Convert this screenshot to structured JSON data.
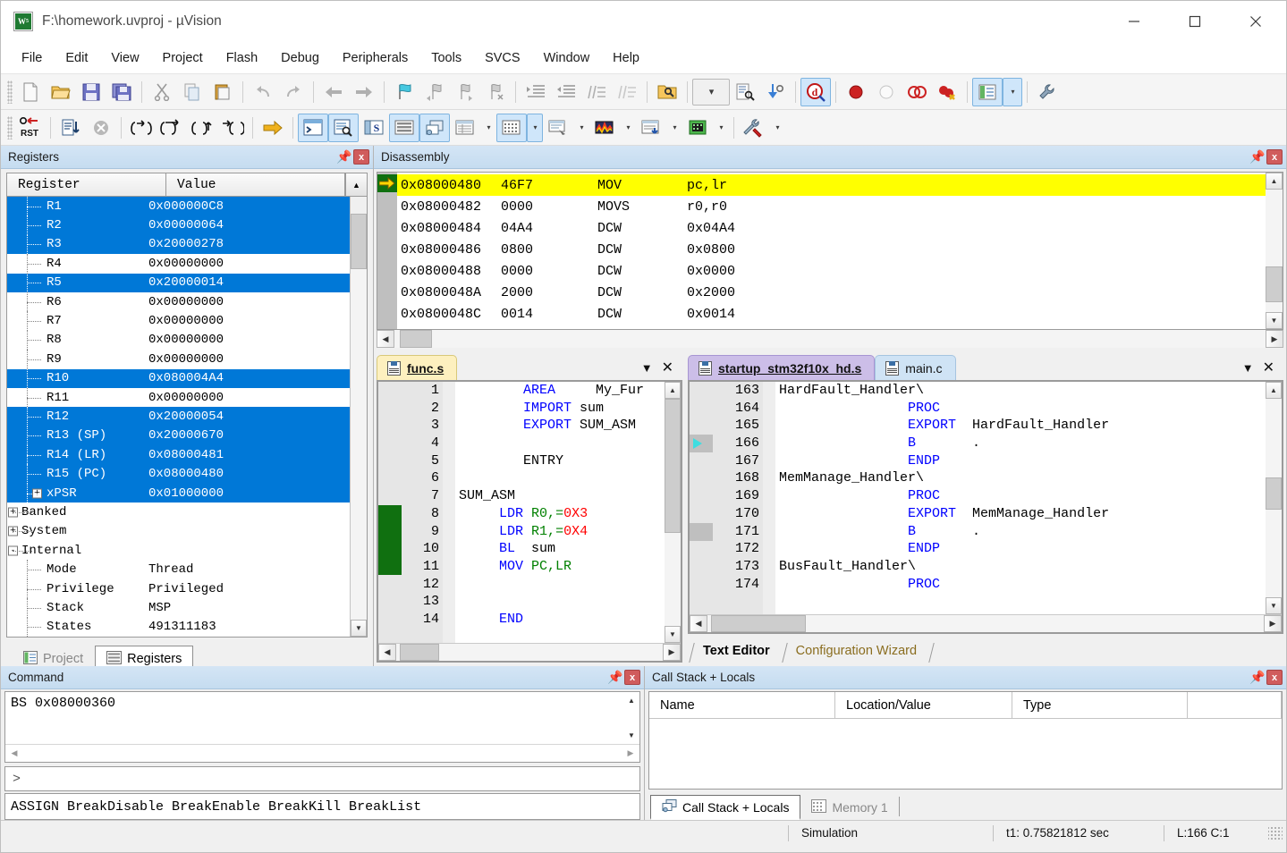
{
  "window": {
    "title": "F:\\homework.uvproj - µVision",
    "icon": "uvision-logo-icon",
    "controls": {
      "minimize": "minimize-icon",
      "maximize": "maximize-icon",
      "close": "close-icon"
    }
  },
  "menubar": {
    "items": [
      "File",
      "Edit",
      "View",
      "Project",
      "Flash",
      "Debug",
      "Peripherals",
      "Tools",
      "SVCS",
      "Window",
      "Help"
    ]
  },
  "toolbar_main": {
    "buttons": [
      {
        "name": "new-file-icon",
        "glyph": "□"
      },
      {
        "name": "open-file-icon",
        "glyph": "📂"
      },
      {
        "name": "save-icon",
        "glyph": "💾"
      },
      {
        "name": "save-all-icon",
        "glyph": "💾"
      },
      {
        "name": "cut-icon",
        "glyph": "✂"
      },
      {
        "name": "copy-icon",
        "glyph": "⧉"
      },
      {
        "name": "paste-icon",
        "glyph": "📋"
      },
      {
        "name": "undo-icon",
        "glyph": "↶"
      },
      {
        "name": "redo-icon",
        "glyph": "↷"
      },
      {
        "name": "navigate-backward-icon",
        "glyph": "←"
      },
      {
        "name": "navigate-forward-icon",
        "glyph": "→"
      },
      {
        "name": "bookmark-toggle-icon",
        "glyph": "⚑"
      },
      {
        "name": "bookmark-prev-icon",
        "glyph": "⚑"
      },
      {
        "name": "bookmark-next-icon",
        "glyph": "⚑"
      },
      {
        "name": "bookmark-clear-icon",
        "glyph": "⚑"
      },
      {
        "name": "indent-icon",
        "glyph": "⇥"
      },
      {
        "name": "outdent-icon",
        "glyph": "⇤"
      },
      {
        "name": "comment-icon",
        "glyph": "//"
      },
      {
        "name": "uncomment-icon",
        "glyph": "//"
      },
      {
        "name": "find-in-files-icon",
        "glyph": "🔍"
      },
      {
        "name": "find-dropdown-icon",
        "glyph": "▾"
      },
      {
        "name": "find-icon",
        "glyph": "🔎"
      },
      {
        "name": "goto-definition-icon",
        "glyph": "↓"
      },
      {
        "name": "start-stop-debug-icon",
        "glyph": "d",
        "active": true
      },
      {
        "name": "insert-breakpoint-icon",
        "glyph": "●"
      },
      {
        "name": "disable-breakpoint-icon",
        "glyph": "○"
      },
      {
        "name": "disable-all-breakpoints-icon",
        "glyph": "◌"
      },
      {
        "name": "kill-all-breakpoints-icon",
        "glyph": "●"
      },
      {
        "name": "manage-project-items-icon",
        "glyph": "▤",
        "active": true
      },
      {
        "name": "manage-dropdown-icon",
        "glyph": "▾"
      },
      {
        "name": "configure-target-options-icon",
        "glyph": "🔧"
      }
    ]
  },
  "toolbar_debug": {
    "buttons": [
      {
        "name": "reset-cpu-icon",
        "glyph": "RST"
      },
      {
        "name": "run-icon",
        "glyph": "≡↓"
      },
      {
        "name": "stop-icon",
        "glyph": "⊗"
      },
      {
        "name": "step-icon",
        "glyph": "{→}"
      },
      {
        "name": "step-over-icon",
        "glyph": "{}→"
      },
      {
        "name": "step-out-icon",
        "glyph": "{}↑"
      },
      {
        "name": "run-to-cursor-icon",
        "glyph": "→{}"
      },
      {
        "name": "show-next-statement-icon",
        "glyph": "⇨"
      },
      {
        "name": "command-window-icon",
        "glyph": "≥",
        "active": true
      },
      {
        "name": "disassembly-window-icon",
        "glyph": "🔍",
        "active": true
      },
      {
        "name": "symbols-window-icon",
        "glyph": "S"
      },
      {
        "name": "registers-window-icon",
        "glyph": "▤",
        "active": true
      },
      {
        "name": "call-stack-window-icon",
        "glyph": "⧉",
        "active": true
      },
      {
        "name": "watch-windows-icon",
        "glyph": "▦"
      },
      {
        "name": "watch-dropdown-icon",
        "glyph": "▾"
      },
      {
        "name": "memory-windows-icon",
        "glyph": "▦",
        "active": true
      },
      {
        "name": "memory-dropdown-icon",
        "glyph": "▾"
      },
      {
        "name": "serial-windows-icon",
        "glyph": "⌨"
      },
      {
        "name": "serial-dropdown-icon",
        "glyph": "▾"
      },
      {
        "name": "analysis-windows-icon",
        "glyph": "〜"
      },
      {
        "name": "analysis-dropdown-icon",
        "glyph": "▾"
      },
      {
        "name": "trace-windows-icon",
        "glyph": "↓"
      },
      {
        "name": "trace-dropdown-icon",
        "glyph": "▾"
      },
      {
        "name": "system-viewer-icon",
        "glyph": "▣"
      },
      {
        "name": "system-viewer-dropdown-icon",
        "glyph": "▾"
      },
      {
        "name": "toolbox-icon",
        "glyph": "🔨"
      },
      {
        "name": "toolbox-dropdown-icon",
        "glyph": "▾"
      }
    ]
  },
  "registers_panel": {
    "title": "Registers",
    "pin_icon": "pin-icon",
    "close_icon": "close-icon",
    "columns": [
      "Register",
      "Value"
    ],
    "rows": [
      {
        "name": "R1",
        "value": "0x000000C8",
        "selected": true,
        "level": 1
      },
      {
        "name": "R2",
        "value": "0x00000064",
        "selected": true,
        "level": 1
      },
      {
        "name": "R3",
        "value": "0x20000278",
        "selected": true,
        "level": 1
      },
      {
        "name": "R4",
        "value": "0x00000000",
        "selected": false,
        "level": 1
      },
      {
        "name": "R5",
        "value": "0x20000014",
        "selected": true,
        "level": 1
      },
      {
        "name": "R6",
        "value": "0x00000000",
        "selected": false,
        "level": 1
      },
      {
        "name": "R7",
        "value": "0x00000000",
        "selected": false,
        "level": 1
      },
      {
        "name": "R8",
        "value": "0x00000000",
        "selected": false,
        "level": 1
      },
      {
        "name": "R9",
        "value": "0x00000000",
        "selected": false,
        "level": 1
      },
      {
        "name": "R10",
        "value": "0x080004A4",
        "selected": true,
        "level": 1
      },
      {
        "name": "R11",
        "value": "0x00000000",
        "selected": false,
        "level": 1
      },
      {
        "name": "R12",
        "value": "0x20000054",
        "selected": true,
        "level": 1
      },
      {
        "name": "R13 (SP)",
        "value": "0x20000670",
        "selected": true,
        "level": 1
      },
      {
        "name": "R14 (LR)",
        "value": "0x08000481",
        "selected": true,
        "level": 1
      },
      {
        "name": "R15 (PC)",
        "value": "0x08000480",
        "selected": true,
        "level": 1
      },
      {
        "name": "xPSR",
        "value": "0x01000000",
        "selected": true,
        "level": 1,
        "expander": "+"
      },
      {
        "name": "Banked",
        "value": "",
        "selected": false,
        "level": 0,
        "expander": "+"
      },
      {
        "name": "System",
        "value": "",
        "selected": false,
        "level": 0,
        "expander": "+"
      },
      {
        "name": "Internal",
        "value": "",
        "selected": false,
        "level": 0,
        "expander": "-"
      },
      {
        "name": "Mode",
        "value": "Thread",
        "selected": false,
        "level": 1
      },
      {
        "name": "Privilege",
        "value": "Privileged",
        "selected": false,
        "level": 1
      },
      {
        "name": "Stack",
        "value": "MSP",
        "selected": false,
        "level": 1
      },
      {
        "name": "States",
        "value": "491311183",
        "selected": false,
        "level": 1
      }
    ],
    "tabs": [
      {
        "label": "Project",
        "icon": "project-icon",
        "active": false
      },
      {
        "label": "Registers",
        "icon": "registers-icon",
        "active": true
      }
    ]
  },
  "disassembly_panel": {
    "title": "Disassembly",
    "pin_icon": "pin-icon",
    "close_icon": "close-icon",
    "current_marker_icon": "execution-arrow-icon",
    "lines": [
      {
        "address": "0x08000480",
        "opcode": "46F7",
        "mnemonic": "MOV",
        "operands": "pc,lr",
        "current": true
      },
      {
        "address": "0x08000482",
        "opcode": "0000",
        "mnemonic": "MOVS",
        "operands": "r0,r0",
        "current": false
      },
      {
        "address": "0x08000484",
        "opcode": "04A4",
        "mnemonic": "DCW",
        "operands": "0x04A4",
        "current": false
      },
      {
        "address": "0x08000486",
        "opcode": "0800",
        "mnemonic": "DCW",
        "operands": "0x0800",
        "current": false
      },
      {
        "address": "0x08000488",
        "opcode": "0000",
        "mnemonic": "DCW",
        "operands": "0x0000",
        "current": false
      },
      {
        "address": "0x0800048A",
        "opcode": "2000",
        "mnemonic": "DCW",
        "operands": "0x2000",
        "current": false
      },
      {
        "address": "0x0800048C",
        "opcode": "0014",
        "mnemonic": "DCW",
        "operands": "0x0014",
        "current": false
      }
    ]
  },
  "editor_func": {
    "tab": {
      "label": "func.s",
      "icon": "source-file-icon"
    },
    "dropdown_icon": "chevron-down-icon",
    "close_icon": "close-icon",
    "first_line": 1,
    "bookmark_lines": [
      8,
      11
    ],
    "lines": [
      {
        "no": 1,
        "tokens": [
          {
            "t": "        ",
            "c": ""
          },
          {
            "t": "AREA",
            "c": "kw"
          },
          {
            "t": "     My_Fur",
            "c": ""
          }
        ]
      },
      {
        "no": 2,
        "tokens": [
          {
            "t": "        ",
            "c": ""
          },
          {
            "t": "IMPORT",
            "c": "kw"
          },
          {
            "t": " sum",
            "c": ""
          }
        ]
      },
      {
        "no": 3,
        "tokens": [
          {
            "t": "        ",
            "c": ""
          },
          {
            "t": "EXPORT",
            "c": "kw"
          },
          {
            "t": " SUM_ASM",
            "c": ""
          }
        ]
      },
      {
        "no": 4,
        "tokens": []
      },
      {
        "no": 5,
        "tokens": [
          {
            "t": "        ENTRY",
            "c": ""
          }
        ]
      },
      {
        "no": 6,
        "tokens": []
      },
      {
        "no": 7,
        "tokens": [
          {
            "t": "SUM_ASM",
            "c": ""
          }
        ]
      },
      {
        "no": 8,
        "tokens": [
          {
            "t": "     ",
            "c": ""
          },
          {
            "t": "LDR",
            "c": "kw"
          },
          {
            "t": " ",
            "c": ""
          },
          {
            "t": "R0,",
            "c": "reg-c"
          },
          {
            "t": "=",
            "c": "reg-c"
          },
          {
            "t": "0X3",
            "c": "num-c"
          }
        ]
      },
      {
        "no": 9,
        "tokens": [
          {
            "t": "     ",
            "c": ""
          },
          {
            "t": "LDR",
            "c": "kw"
          },
          {
            "t": " ",
            "c": ""
          },
          {
            "t": "R1,",
            "c": "reg-c"
          },
          {
            "t": "=",
            "c": "reg-c"
          },
          {
            "t": "0X4",
            "c": "num-c"
          }
        ]
      },
      {
        "no": 10,
        "tokens": [
          {
            "t": "     ",
            "c": ""
          },
          {
            "t": "BL",
            "c": "kw"
          },
          {
            "t": "  sum",
            "c": ""
          }
        ]
      },
      {
        "no": 11,
        "tokens": [
          {
            "t": "     ",
            "c": ""
          },
          {
            "t": "MOV",
            "c": "kw"
          },
          {
            "t": " ",
            "c": ""
          },
          {
            "t": "PC,LR",
            "c": "reg-c"
          }
        ]
      },
      {
        "no": 12,
        "tokens": []
      },
      {
        "no": 13,
        "tokens": []
      },
      {
        "no": 14,
        "tokens": [
          {
            "t": "     ",
            "c": ""
          },
          {
            "t": "END",
            "c": "kw"
          }
        ]
      }
    ]
  },
  "editor_startup": {
    "tabs": [
      {
        "label": "startup_stm32f10x_hd.s",
        "icon": "source-file-icon",
        "active": true
      },
      {
        "label": "main.c",
        "icon": "source-file-icon",
        "active": false
      }
    ],
    "dropdown_icon": "chevron-down-icon",
    "close_icon": "close-icon",
    "marker_line": 166,
    "marker_icon": "current-line-arrow-icon",
    "bookmark_line": 171,
    "lines": [
      {
        "no": 163,
        "tokens": [
          {
            "t": "HardFault_Handler\\",
            "c": ""
          }
        ]
      },
      {
        "no": 164,
        "tokens": [
          {
            "t": "                ",
            "c": ""
          },
          {
            "t": "PROC",
            "c": "kw"
          }
        ]
      },
      {
        "no": 165,
        "tokens": [
          {
            "t": "                ",
            "c": ""
          },
          {
            "t": "EXPORT",
            "c": "kw"
          },
          {
            "t": "  HardFault_Handler",
            "c": ""
          }
        ]
      },
      {
        "no": 166,
        "tokens": [
          {
            "t": "                ",
            "c": ""
          },
          {
            "t": "B",
            "c": "kw"
          },
          {
            "t": "       .",
            "c": ""
          }
        ]
      },
      {
        "no": 167,
        "tokens": [
          {
            "t": "                ",
            "c": ""
          },
          {
            "t": "ENDP",
            "c": "kw"
          }
        ]
      },
      {
        "no": 168,
        "tokens": [
          {
            "t": "MemManage_Handler\\",
            "c": ""
          }
        ]
      },
      {
        "no": 169,
        "tokens": [
          {
            "t": "                ",
            "c": ""
          },
          {
            "t": "PROC",
            "c": "kw"
          }
        ]
      },
      {
        "no": 170,
        "tokens": [
          {
            "t": "                ",
            "c": ""
          },
          {
            "t": "EXPORT",
            "c": "kw"
          },
          {
            "t": "  MemManage_Handler",
            "c": ""
          }
        ]
      },
      {
        "no": 171,
        "tokens": [
          {
            "t": "                ",
            "c": ""
          },
          {
            "t": "B",
            "c": "kw"
          },
          {
            "t": "       .",
            "c": ""
          }
        ]
      },
      {
        "no": 172,
        "tokens": [
          {
            "t": "                ",
            "c": ""
          },
          {
            "t": "ENDP",
            "c": "kw"
          }
        ]
      },
      {
        "no": 173,
        "tokens": [
          {
            "t": "BusFault_Handler\\",
            "c": ""
          }
        ]
      },
      {
        "no": 174,
        "tokens": [
          {
            "t": "                ",
            "c": ""
          },
          {
            "t": "PROC",
            "c": "kw"
          }
        ]
      }
    ],
    "footer_tabs": [
      {
        "label": "Text Editor",
        "active": true
      },
      {
        "label": "Configuration Wizard",
        "active": false
      }
    ]
  },
  "command_panel": {
    "title": "Command",
    "pin_icon": "pin-icon",
    "close_icon": "close-icon",
    "output": "BS 0x08000360",
    "prompt": ">",
    "input_value": "",
    "hints": "ASSIGN BreakDisable BreakEnable BreakKill BreakList"
  },
  "callstack_panel": {
    "title": "Call Stack + Locals",
    "pin_icon": "pin-icon",
    "close_icon": "close-icon",
    "columns": [
      "Name",
      "Location/Value",
      "Type"
    ],
    "rows": [],
    "tabs": [
      {
        "label": "Call Stack + Locals",
        "icon": "call-stack-icon",
        "active": true
      },
      {
        "label": "Memory 1",
        "icon": "memory-icon",
        "active": false
      }
    ]
  },
  "statusbar": {
    "cells": [
      "Simulation",
      "t1: 0.75821812 sec",
      "L:166 C:1"
    ]
  },
  "colors": {
    "selection_blue": "#0078d7",
    "current_line_yellow": "#ffff00",
    "keyword_blue": "#0000ff",
    "register_green": "#008000",
    "number_red": "#ff0000",
    "panel_header": "#c5dcf0",
    "bookmark_green": "#107010"
  }
}
